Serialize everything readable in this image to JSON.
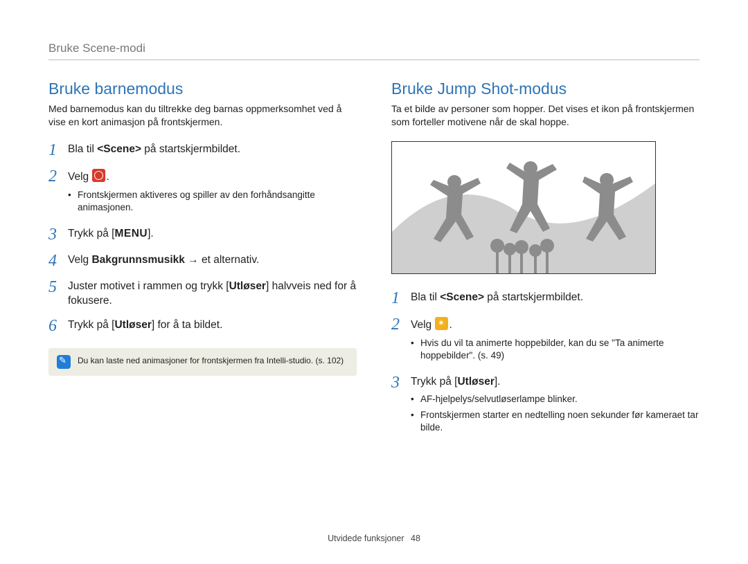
{
  "breadcrumb": "Bruke Scene-modi",
  "left": {
    "title": "Bruke barnemodus",
    "lead": "Med barnemodus kan du tiltrekke deg barnas oppmerksomhet ved å vise en kort animasjon på frontskjermen.",
    "steps": {
      "s1": {
        "num": "1",
        "pre": "Bla til ",
        "scene": "<Scene>",
        "post": " på startskjermbildet."
      },
      "s2": {
        "num": "2",
        "text": "Velg ",
        "iconName": "children-mode-icon",
        "period": ".",
        "bullets": [
          "Frontskjermen aktiveres og spiller av den forhåndsangitte animasjonen."
        ]
      },
      "s3": {
        "num": "3",
        "pre": "Trykk på [",
        "menu": "MENU",
        "post": "]."
      },
      "s4": {
        "num": "4",
        "pre": "Velg ",
        "bold": "Bakgrunnsmusikk",
        "arrow": " → et alternativ."
      },
      "s5": {
        "num": "5",
        "pre": "Juster motivet i rammen og trykk [",
        "bold": "Utløser",
        "post": "] halvveis ned for å fokusere."
      },
      "s6": {
        "num": "6",
        "pre": "Trykk på [",
        "bold": "Utløser",
        "post": "] for å ta bildet."
      }
    },
    "note": "Du kan laste ned animasjoner for frontskjermen fra Intelli-studio. (s. 102)"
  },
  "right": {
    "title": "Bruke Jump Shot-modus",
    "lead": "Ta et bilde av personer som hopper. Det vises et ikon på frontskjermen som forteller motivene når de skal hoppe.",
    "steps": {
      "s1": {
        "num": "1",
        "pre": "Bla til ",
        "scene": "<Scene>",
        "post": " på startskjermbildet."
      },
      "s2": {
        "num": "2",
        "text": "Velg ",
        "iconName": "jump-shot-icon",
        "period": ".",
        "bullets": [
          "Hvis du vil ta animerte hoppebilder, kan du se \"Ta animerte hoppebilder\". (s. 49)"
        ]
      },
      "s3": {
        "num": "3",
        "pre": "Trykk på [",
        "bold": "Utløser",
        "post": "].",
        "bullets": [
          "AF-hjelpelys/selvutløserlampe blinker.",
          "Frontskjermen starter en nedtelling noen sekunder før kameraet tar bilde."
        ]
      }
    }
  },
  "footer": {
    "text": "Utvidede funksjoner",
    "page": "48"
  }
}
